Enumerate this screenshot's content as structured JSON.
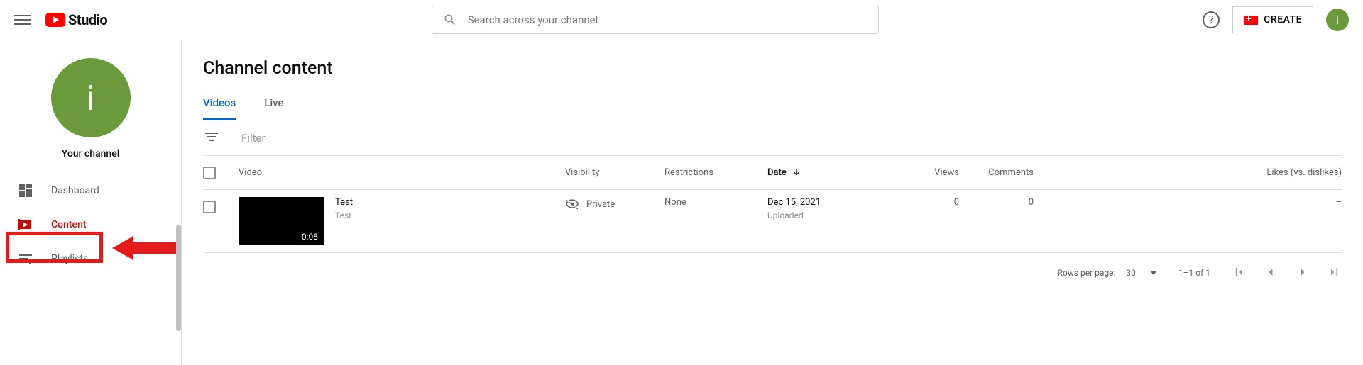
{
  "header": {
    "logo_text": "Studio",
    "search_placeholder": "Search across your channel",
    "create_label": "CREATE",
    "avatar_letter": "i"
  },
  "sidebar": {
    "channel_avatar_letter": "i",
    "channel_label": "Your channel",
    "items": [
      {
        "key": "dashboard",
        "label": "Dashboard",
        "active": false
      },
      {
        "key": "content",
        "label": "Content",
        "active": true
      },
      {
        "key": "playlists",
        "label": "Playlists",
        "active": false
      }
    ]
  },
  "main": {
    "title": "Channel content",
    "tabs": [
      {
        "label": "Videos",
        "active": true
      },
      {
        "label": "Live",
        "active": false
      }
    ],
    "filter_label": "Filter",
    "columns": {
      "video": "Video",
      "visibility": "Visibility",
      "restrictions": "Restrictions",
      "date": "Date",
      "views": "Views",
      "comments": "Comments",
      "likes": "Likes (vs. dislikes)"
    },
    "rows": [
      {
        "title": "Test",
        "description": "Test",
        "duration": "0:08",
        "visibility": "Private",
        "restrictions": "None",
        "date": "Dec 15, 2021",
        "date_sub": "Uploaded",
        "views": "0",
        "comments": "0",
        "likes": "–"
      }
    ],
    "pager": {
      "rows_label": "Rows per page:",
      "rows_value": "30",
      "range": "1–1 of 1"
    }
  }
}
